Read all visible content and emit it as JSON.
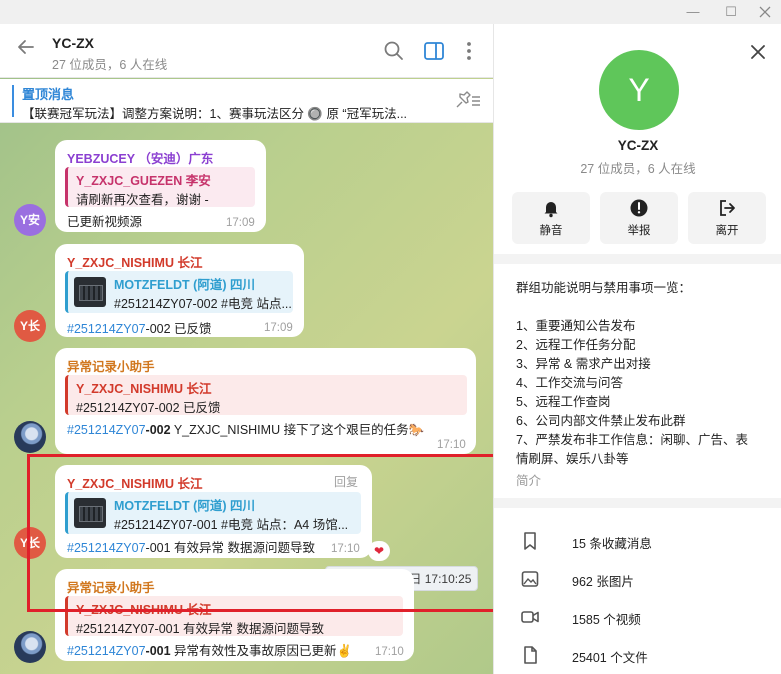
{
  "window": {
    "minimize_glyph": "—",
    "maximize_glyph": "☐"
  },
  "chat": {
    "title": "YC-ZX",
    "subtitle": "27 位成员，6 人在线",
    "pinned": {
      "title": "置顶消息",
      "text": "【联赛冠军玩法】调整方案说明：1、赛事玩法区分 🔘 原 “冠军玩法..."
    },
    "messages": [
      {
        "sender": "YEBZUCEY （安迪）广东",
        "quote_name": "Y_ZXJC_GUEZEN 李安",
        "quote_text": "请刷新再次查看，谢谢 -",
        "text": "已更新视频源",
        "time": "17:09",
        "avatar_text": "Y安"
      },
      {
        "sender": "Y_ZXJC_NISHIMU 长江",
        "quote_name": "MOTZFELDT (阿道) 四川",
        "quote_text": "#251214ZY07-002 #电竞 站点...",
        "tag": "#251214ZY07",
        "text": "-002 已反馈",
        "time": "17:09",
        "avatar_text": "Y长"
      },
      {
        "sender": "异常记录小助手",
        "quote_name": "Y_ZXJC_NISHIMU 长江",
        "quote_text": "#251214ZY07-002 已反馈",
        "tag": "#251214ZY07",
        "text_bold": "-002",
        "text": " Y_ZXJC_NISHIMU 接下了这个艰巨的任务🐎",
        "time": "17:10"
      },
      {
        "sender": "Y_ZXJC_NISHIMU 长江",
        "reply_label": "回复",
        "quote_name": "MOTZFELDT (阿道) 四川",
        "quote_text": "#251214ZY07-001 #电竞 站点：A4 场馆...",
        "tag": "#251214ZY07",
        "text": "-001 有效异常 数据源问题导致",
        "time": "17:10",
        "reaction": "❤",
        "date_tooltip": "2025年12月14日 17:10:25",
        "avatar_text": "Y长"
      },
      {
        "sender": "异常记录小助手",
        "quote_name": "Y_ZXJC_NISHIMU 长江",
        "quote_text": "#251214ZY07-001 有效异常 数据源问题导致",
        "tag": "#251214ZY07",
        "text_bold": "-001",
        "text": " 异常有效性及事故原因已更新✌️",
        "time": "17:10"
      }
    ]
  },
  "info": {
    "avatar_letter": "Y",
    "title": "YC-ZX",
    "subtitle": "27 位成员，6 人在线",
    "actions": [
      {
        "label": "静音",
        "icon": "bell-icon"
      },
      {
        "label": "举报",
        "icon": "alert-icon"
      },
      {
        "label": "离开",
        "icon": "leave-icon"
      }
    ],
    "description": [
      "群组功能说明与禁用事项一览：",
      "",
      "1、重要通知公告发布",
      "2、远程工作任务分配",
      "3、异常 & 需求产出对接",
      "4、工作交流与问答",
      "5、远程工作查岗",
      "6、公司内部文件禁止发布此群",
      "7、严禁发布非工作信息：闲聊、广告、表",
      "情刷屏、娱乐八卦等"
    ],
    "description_more": "简介",
    "stats": [
      {
        "label": "15 条收藏消息",
        "icon": "bookmark-icon"
      },
      {
        "label": "962 张图片",
        "icon": "image-icon"
      },
      {
        "label": "1585 个视频",
        "icon": "video-icon"
      },
      {
        "label": "25401 个文件",
        "icon": "file-icon"
      }
    ]
  },
  "colors": {
    "accent": "#2f86d6",
    "avatar_green": "#5fc65a",
    "sender_purple": "#8b3fd1",
    "sender_red": "#d23a2b",
    "sender_orange": "#d1771e",
    "highlight_red": "#e0202a"
  }
}
